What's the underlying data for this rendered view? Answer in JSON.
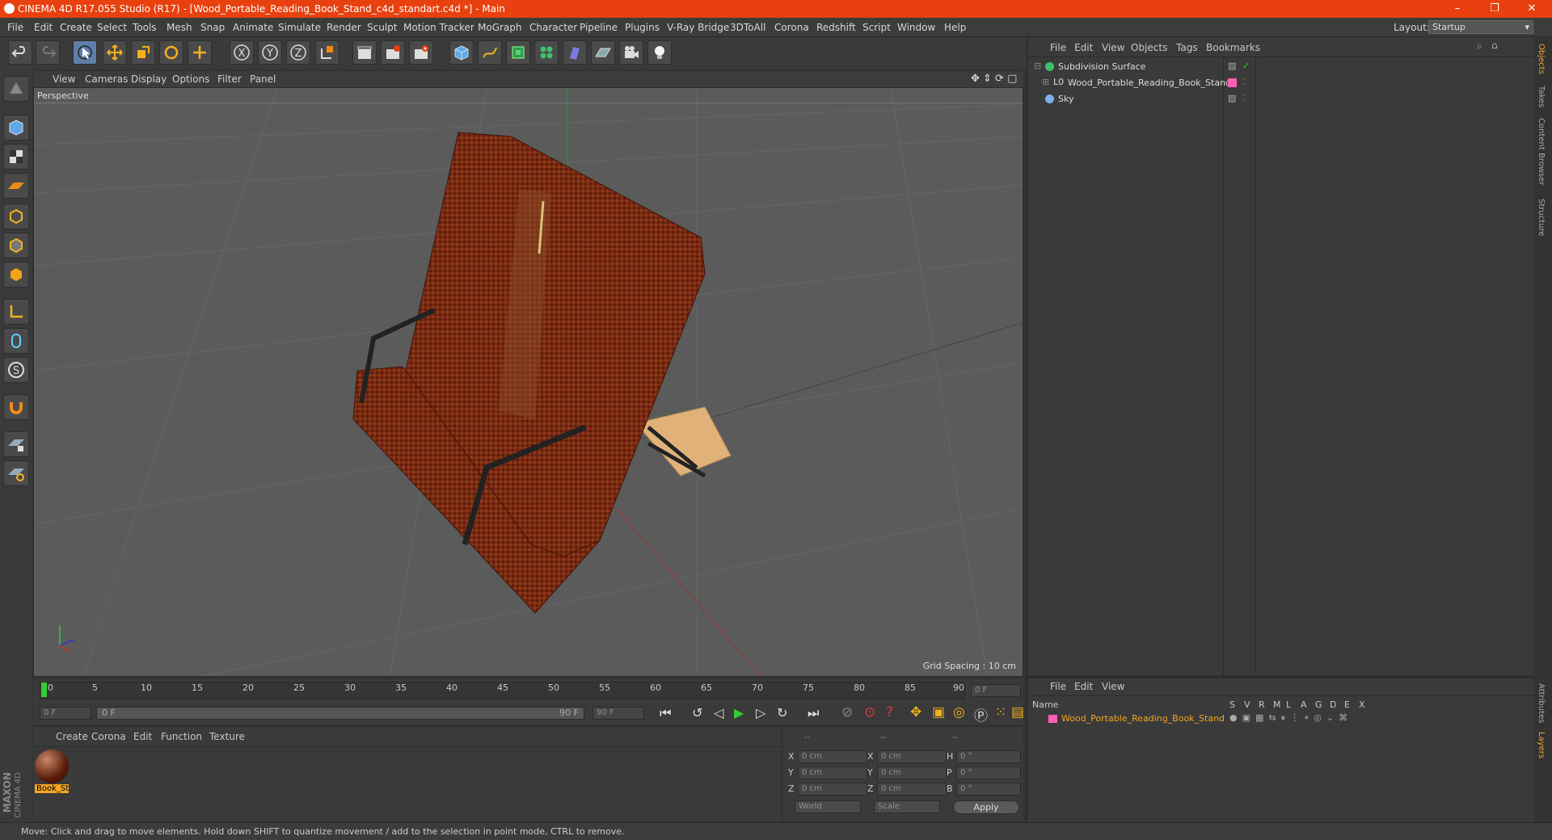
{
  "titlebar": {
    "title": "CINEMA 4D R17.055 Studio (R17) - [Wood_Portable_Reading_Book_Stand_c4d_standart.c4d *] - Main",
    "minimize": "–",
    "restore": "❐",
    "close": "✕"
  },
  "menubar": {
    "items": [
      "File",
      "Edit",
      "Create",
      "Select",
      "Tools",
      "Mesh",
      "Snap",
      "Animate",
      "Simulate",
      "Render",
      "Sculpt",
      "Motion Tracker",
      "MoGraph",
      "Character",
      "Pipeline",
      "Plugins",
      "V-Ray Bridge",
      "3DToAll",
      "Corona",
      "Redshift",
      "Script",
      "Window",
      "Help"
    ],
    "layout_label": "Layout:",
    "layout_value": "Startup"
  },
  "viewport": {
    "menu": [
      "View",
      "Cameras",
      "Display",
      "Options",
      "Filter",
      "Panel"
    ],
    "label": "Perspective",
    "grid_spacing": "Grid Spacing : 10 cm"
  },
  "timeline": {
    "ticks": [
      "0",
      "5",
      "10",
      "15",
      "20",
      "25",
      "30",
      "35",
      "40",
      "45",
      "50",
      "55",
      "60",
      "65",
      "70",
      "75",
      "80",
      "85",
      "90"
    ],
    "current_frame": "0 F",
    "start_field": "0 F",
    "range_start": "0 F",
    "range_end": "90 F",
    "end_field": "90 F"
  },
  "material_panel": {
    "menu": [
      "Create",
      "Corona",
      "Edit",
      "Function",
      "Texture"
    ],
    "material_name": "Book_St"
  },
  "coord_panel": {
    "headers": [
      "--",
      "--",
      "--"
    ],
    "rows": [
      {
        "a": "X",
        "av": "0 cm",
        "b": "X",
        "bv": "0 cm",
        "c": "H",
        "cv": "0 °"
      },
      {
        "a": "Y",
        "av": "0 cm",
        "b": "Y",
        "bv": "0 cm",
        "c": "P",
        "cv": "0 °"
      },
      {
        "a": "Z",
        "av": "0 cm",
        "b": "Z",
        "bv": "0 cm",
        "c": "B",
        "cv": "0 °"
      }
    ],
    "world": "World",
    "scale": "Scale",
    "apply": "Apply"
  },
  "object_manager": {
    "menu": [
      "File",
      "Edit",
      "View",
      "Objects",
      "Tags",
      "Bookmarks"
    ],
    "objects": [
      {
        "name": "Subdivision Surface"
      },
      {
        "name": "Wood_Portable_Reading_Book_Stand"
      },
      {
        "name": "Sky"
      }
    ]
  },
  "layer_manager": {
    "menu": [
      "File",
      "Edit",
      "View"
    ],
    "col_name": "Name",
    "cols": [
      "S",
      "V",
      "R",
      "M",
      "L",
      "A",
      "G",
      "D",
      "E",
      "X"
    ],
    "layer_name": "Wood_Portable_Reading_Book_Stand"
  },
  "right_tabs": [
    "Objects",
    "Takes",
    "Content Browser",
    "Structure"
  ],
  "right_tabs_bottom": [
    "Attributes",
    "Layers"
  ],
  "brand": {
    "maxon": "MAXON",
    "c4d": "CINEMA 4D"
  },
  "status": "Move: Click and drag to move elements. Hold down SHIFT to quantize movement / add to the selection in point mode, CTRL to remove.",
  "colors": {
    "accent": "#e8400e",
    "selection": "#f4a623",
    "layer_pink": "#ff5fb4"
  }
}
